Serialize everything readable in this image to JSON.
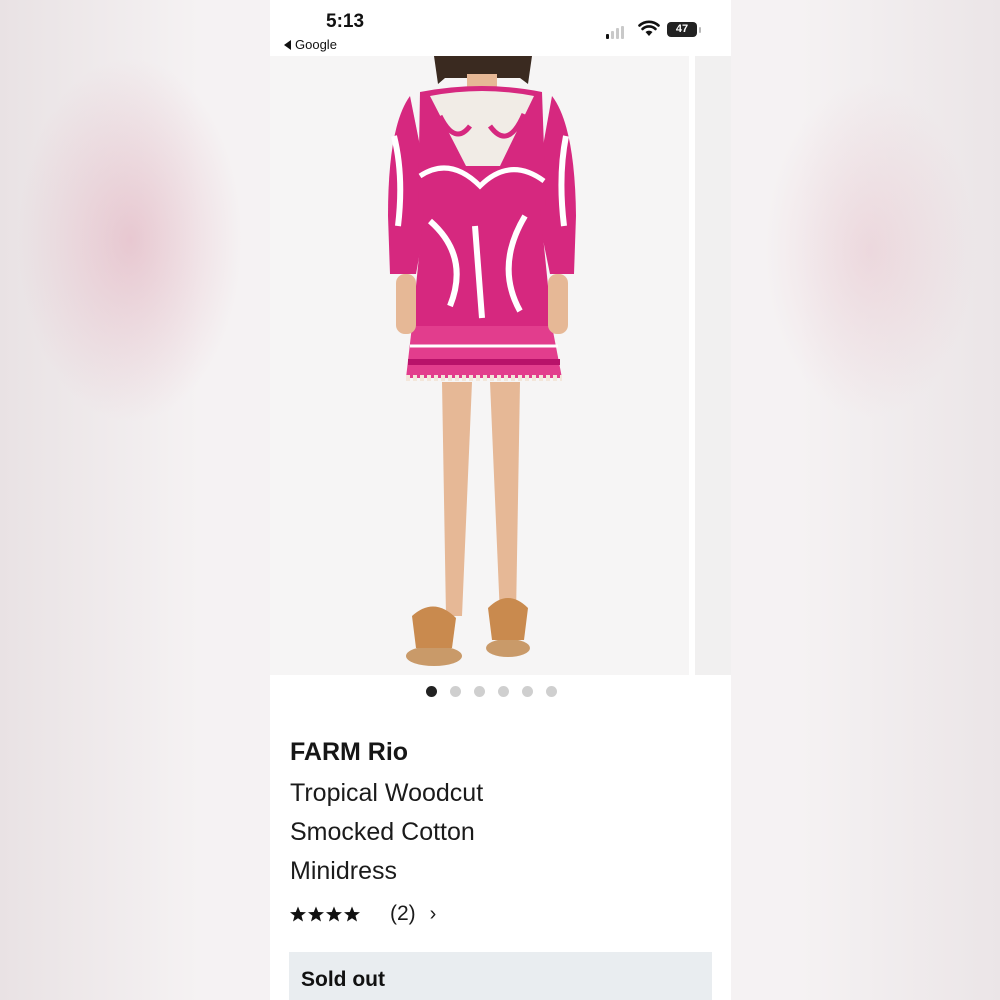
{
  "status_bar": {
    "time": "5:13",
    "back_app": "Google",
    "battery": "47"
  },
  "carousel": {
    "image_alt": "Model wearing pink and white tropical print smocked minidress with sandals",
    "total_slides": 6,
    "active_index": 0
  },
  "product": {
    "brand": "FARM Rio",
    "title_lines": [
      "Tropical Woodcut",
      "Smocked Cotton",
      "Minidress"
    ],
    "rating": 4.5,
    "review_count": "(2)",
    "availability": "Sold out"
  },
  "colors": {
    "dress_pink": "#d6287f",
    "sold_out_bg": "#e9edf0"
  }
}
